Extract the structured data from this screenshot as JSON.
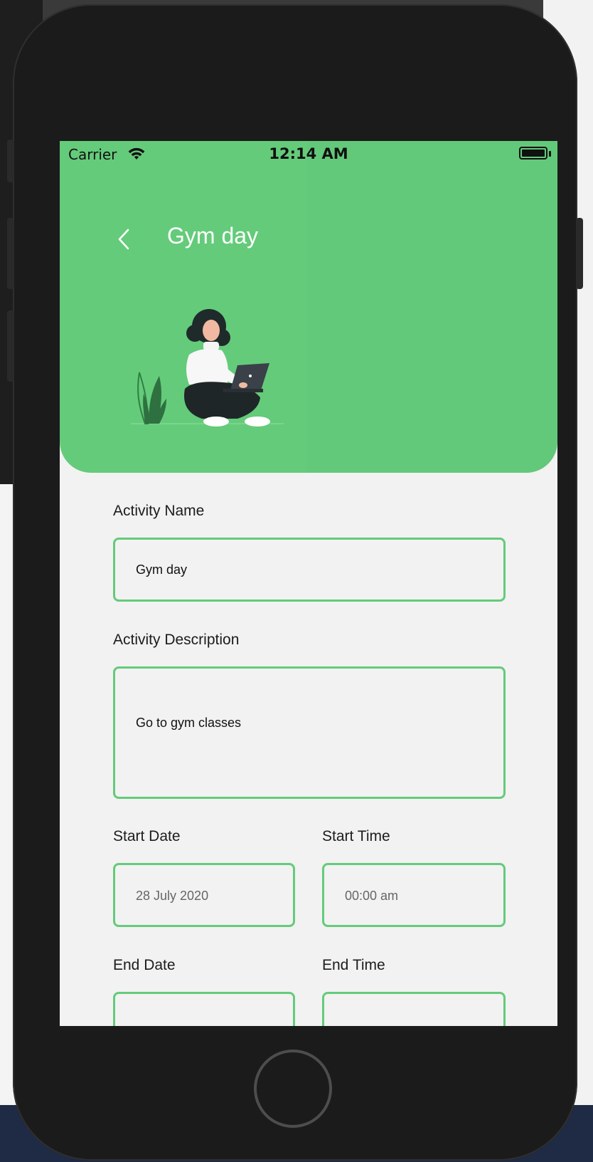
{
  "status_bar": {
    "carrier": "Carrier",
    "time": "12:14 AM"
  },
  "header": {
    "title": "Gym day",
    "back_icon": "chevron-left-icon"
  },
  "form": {
    "activity_name": {
      "label": "Activity Name",
      "value": "Gym day"
    },
    "activity_description": {
      "label": "Activity Description",
      "value": "Go to gym classes"
    },
    "start_date": {
      "label": "Start Date",
      "value": "28 July 2020"
    },
    "start_time": {
      "label": "Start Time",
      "value": "00:00 am"
    },
    "end_date": {
      "label": "End Date",
      "value": ""
    },
    "end_time": {
      "label": "End Time",
      "value": ""
    }
  },
  "colors": {
    "accent": "#64cb7a",
    "background": "#f2f2f2",
    "device": "#1b1b1b"
  }
}
